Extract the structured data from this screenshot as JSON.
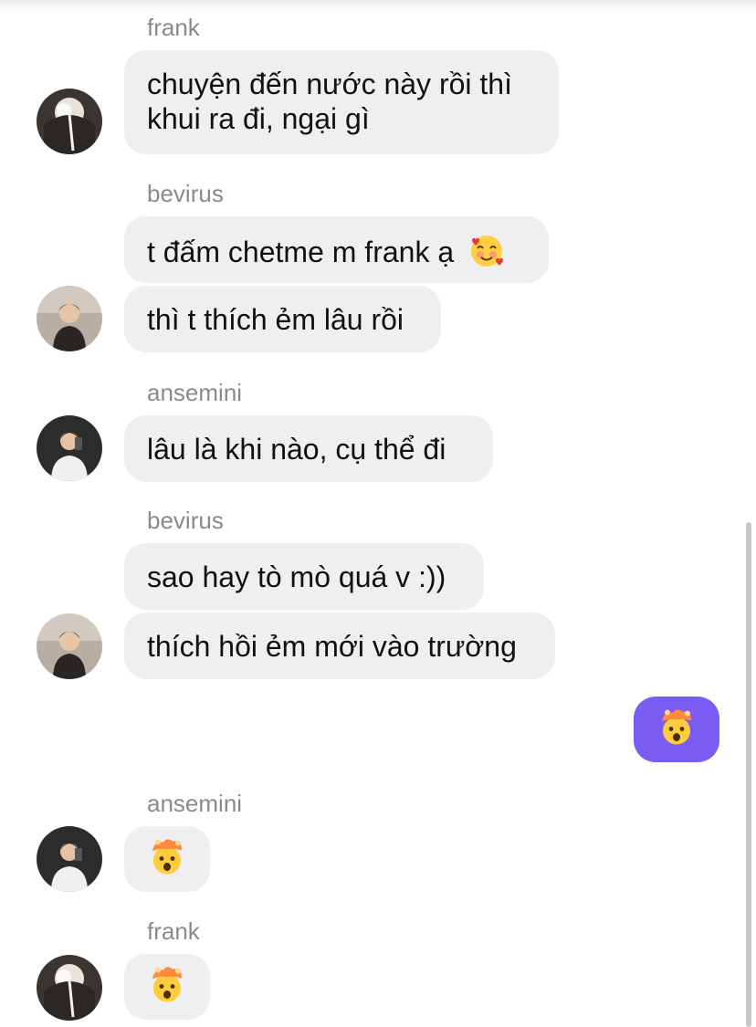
{
  "conversation": {
    "messages": [
      {
        "sender": "frank",
        "text": "chuyện đến nước này rồi thì khui ra đi, ngại gì"
      },
      {
        "sender": "bevirus",
        "text": "t đấm chetme m frank ạ",
        "emoji": "smiling-face-with-hearts"
      },
      {
        "sender": "bevirus",
        "text": "thì t thích ẻm lâu rồi"
      },
      {
        "sender": "ansemini",
        "text": "lâu là khi nào, cụ thể đi"
      },
      {
        "sender": "bevirus",
        "text": "sao hay tò mò quá v :))"
      },
      {
        "sender": "bevirus",
        "text": "thích hồi ẻm mới vào trường"
      },
      {
        "sender": "me",
        "emoji": "exploding-head",
        "bubble_color": "#7a5cf5"
      },
      {
        "sender": "ansemini",
        "emoji": "exploding-head"
      },
      {
        "sender": "frank",
        "emoji": "exploding-head"
      }
    ],
    "colors": {
      "incoming_bubble": "#efeff1",
      "outgoing_bubble": "#7a5cf5",
      "sender_name": "#8a8a8e"
    }
  }
}
